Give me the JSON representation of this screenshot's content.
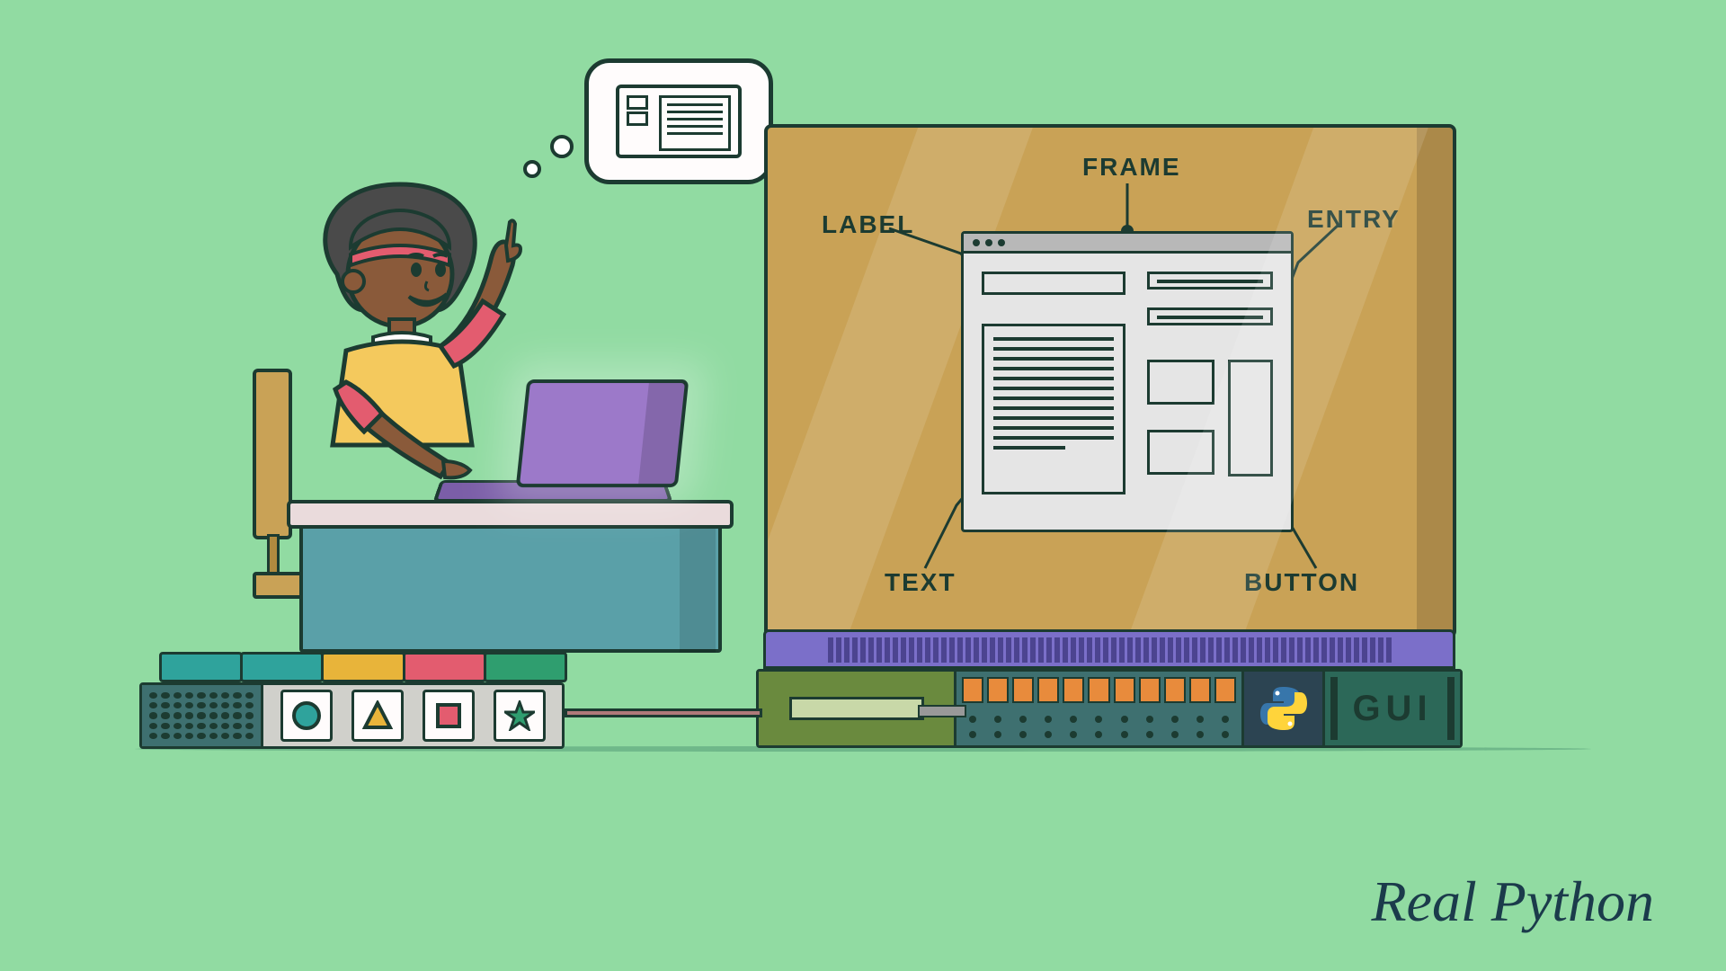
{
  "diagram": {
    "labels": {
      "frame": "FRAME",
      "label": "LABEL",
      "entry": "ENTRY",
      "text": "TEXT",
      "button": "BUTTON"
    }
  },
  "bottom_panel": {
    "gui_text": "GUI"
  },
  "watermark": "Real Python",
  "colors": {
    "block_teal": "#2FA39C",
    "block_yellow": "#E8B43A",
    "block_pink": "#E35C6F",
    "block_green": "#2F9E6F",
    "shape_circle": "#2FA39C",
    "shape_triangle": "#E8B43A",
    "shape_square": "#E35C6F",
    "shape_star": "#2F9E6F"
  }
}
